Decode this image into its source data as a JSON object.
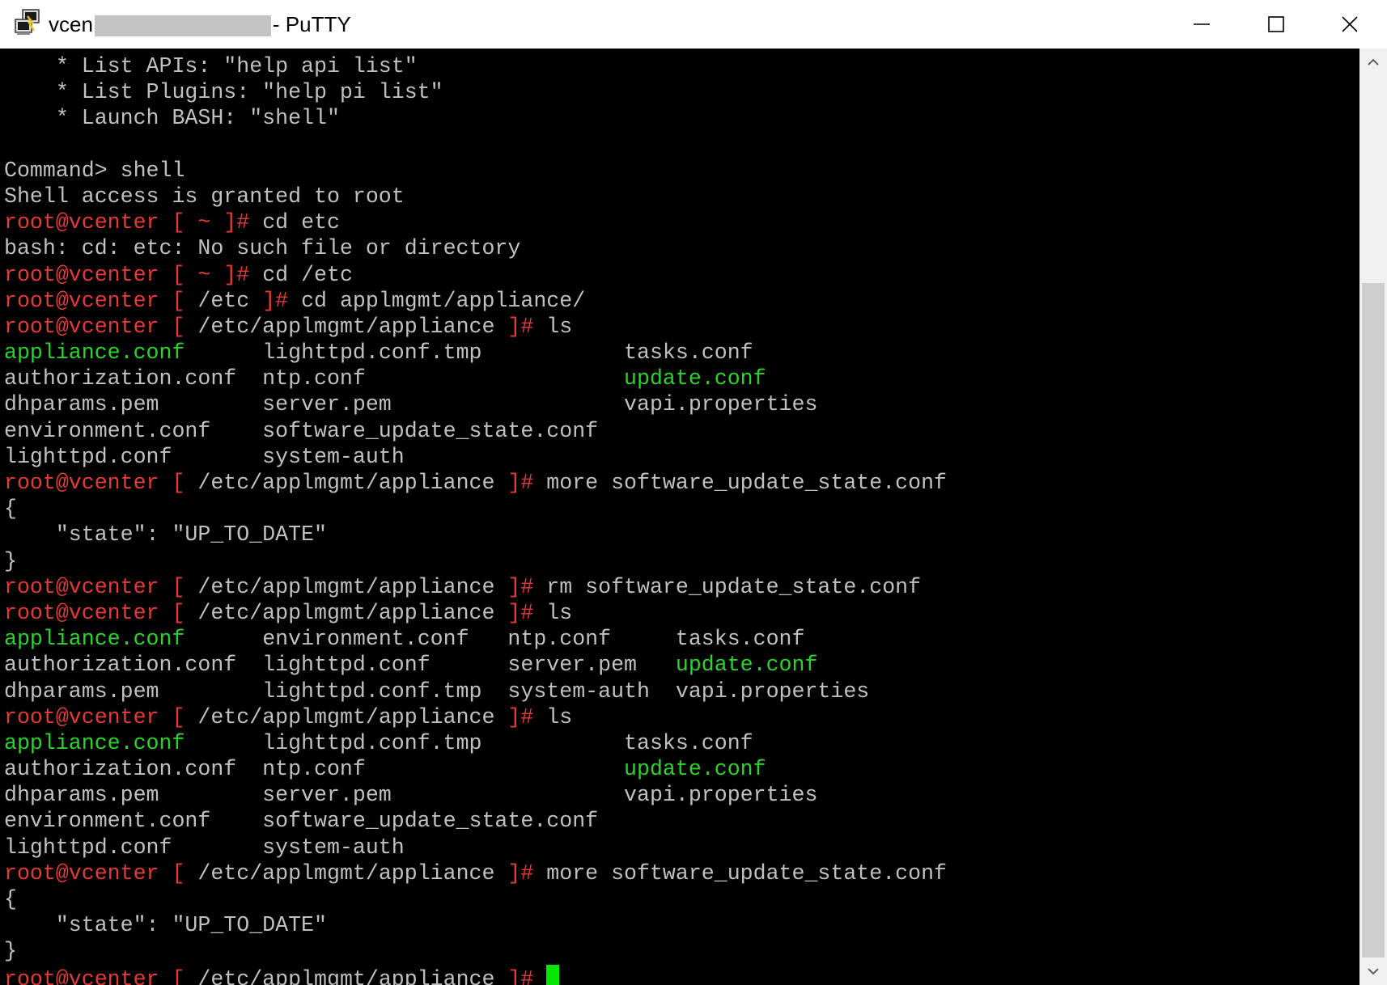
{
  "window": {
    "title_prefix": "vcen",
    "title_suffix": "- PuTTY",
    "app_icon": "putty-icon",
    "controls": {
      "minimize": "minimize-icon",
      "maximize": "maximize-icon",
      "close": "close-icon"
    }
  },
  "colors": {
    "terminal_bg": "#000000",
    "text_default": "#c0c0c0",
    "prompt_red": "#e23b3b",
    "file_green": "#2ed22e",
    "cursor_green": "#00e600"
  },
  "scrollbar": {
    "up": "scroll-up-arrow-icon",
    "down": "scroll-down-arrow-icon"
  },
  "terminal": {
    "lines": [
      [
        {
          "t": "    * List APIs: \"help api list\""
        }
      ],
      [
        {
          "t": "    * List Plugins: \"help pi list\""
        }
      ],
      [
        {
          "t": "    * Launch BASH: \"shell\""
        }
      ],
      [
        {
          "t": ""
        }
      ],
      [
        {
          "t": "Command> shell"
        }
      ],
      [
        {
          "t": "Shell access is granted to root"
        }
      ],
      [
        {
          "t": "root@vcenter [ ~ ]# ",
          "c": "prompt"
        },
        {
          "t": "cd etc"
        }
      ],
      [
        {
          "t": "bash: cd: etc: No such file or directory"
        }
      ],
      [
        {
          "t": "root@vcenter [ ~ ]# ",
          "c": "prompt"
        },
        {
          "t": "cd /etc"
        }
      ],
      [
        {
          "t": "root@vcenter [ ",
          "c": "prompt"
        },
        {
          "t": "/etc"
        },
        {
          "t": " ]# ",
          "c": "prompt"
        },
        {
          "t": "cd applmgmt/appliance/"
        }
      ],
      [
        {
          "t": "root@vcenter [ ",
          "c": "prompt"
        },
        {
          "t": "/etc/applmgmt/appliance"
        },
        {
          "t": " ]# ",
          "c": "prompt"
        },
        {
          "t": "ls"
        }
      ],
      [
        {
          "t": "appliance.conf",
          "c": "green"
        },
        {
          "t": "      lighttpd.conf.tmp           tasks.conf"
        }
      ],
      [
        {
          "t": "authorization.conf  ntp.conf                    "
        },
        {
          "t": "update.conf",
          "c": "green"
        }
      ],
      [
        {
          "t": "dhparams.pem        server.pem                  vapi.properties"
        }
      ],
      [
        {
          "t": "environment.conf    software_update_state.conf"
        }
      ],
      [
        {
          "t": "lighttpd.conf       system-auth"
        }
      ],
      [
        {
          "t": "root@vcenter [ ",
          "c": "prompt"
        },
        {
          "t": "/etc/applmgmt/appliance"
        },
        {
          "t": " ]# ",
          "c": "prompt"
        },
        {
          "t": "more software_update_state.conf"
        }
      ],
      [
        {
          "t": "{"
        }
      ],
      [
        {
          "t": "    \"state\": \"UP_TO_DATE\""
        }
      ],
      [
        {
          "t": "}"
        }
      ],
      [
        {
          "t": "root@vcenter [ ",
          "c": "prompt"
        },
        {
          "t": "/etc/applmgmt/appliance"
        },
        {
          "t": " ]# ",
          "c": "prompt"
        },
        {
          "t": "rm software_update_state.conf"
        }
      ],
      [
        {
          "t": "root@vcenter [ ",
          "c": "prompt"
        },
        {
          "t": "/etc/applmgmt/appliance"
        },
        {
          "t": " ]# ",
          "c": "prompt"
        },
        {
          "t": "ls"
        }
      ],
      [
        {
          "t": "appliance.conf",
          "c": "green"
        },
        {
          "t": "      environment.conf   ntp.conf     tasks.conf"
        }
      ],
      [
        {
          "t": "authorization.conf  lighttpd.conf      server.pem   "
        },
        {
          "t": "update.conf",
          "c": "green"
        }
      ],
      [
        {
          "t": "dhparams.pem        lighttpd.conf.tmp  system-auth  vapi.properties"
        }
      ],
      [
        {
          "t": "root@vcenter [ ",
          "c": "prompt"
        },
        {
          "t": "/etc/applmgmt/appliance"
        },
        {
          "t": " ]# ",
          "c": "prompt"
        },
        {
          "t": "ls"
        }
      ],
      [
        {
          "t": "appliance.conf",
          "c": "green"
        },
        {
          "t": "      lighttpd.conf.tmp           tasks.conf"
        }
      ],
      [
        {
          "t": "authorization.conf  ntp.conf                    "
        },
        {
          "t": "update.conf",
          "c": "green"
        }
      ],
      [
        {
          "t": "dhparams.pem        server.pem                  vapi.properties"
        }
      ],
      [
        {
          "t": "environment.conf    software_update_state.conf"
        }
      ],
      [
        {
          "t": "lighttpd.conf       system-auth"
        }
      ],
      [
        {
          "t": "root@vcenter [ ",
          "c": "prompt"
        },
        {
          "t": "/etc/applmgmt/appliance"
        },
        {
          "t": " ]# ",
          "c": "prompt"
        },
        {
          "t": "more software_update_state.conf"
        }
      ],
      [
        {
          "t": "{"
        }
      ],
      [
        {
          "t": "    \"state\": \"UP_TO_DATE\""
        }
      ],
      [
        {
          "t": "}"
        }
      ],
      [
        {
          "t": "root@vcenter [ ",
          "c": "prompt"
        },
        {
          "t": "/etc/applmgmt/appliance"
        },
        {
          "t": " ]# ",
          "c": "prompt"
        },
        {
          "cursor": true
        }
      ]
    ]
  }
}
